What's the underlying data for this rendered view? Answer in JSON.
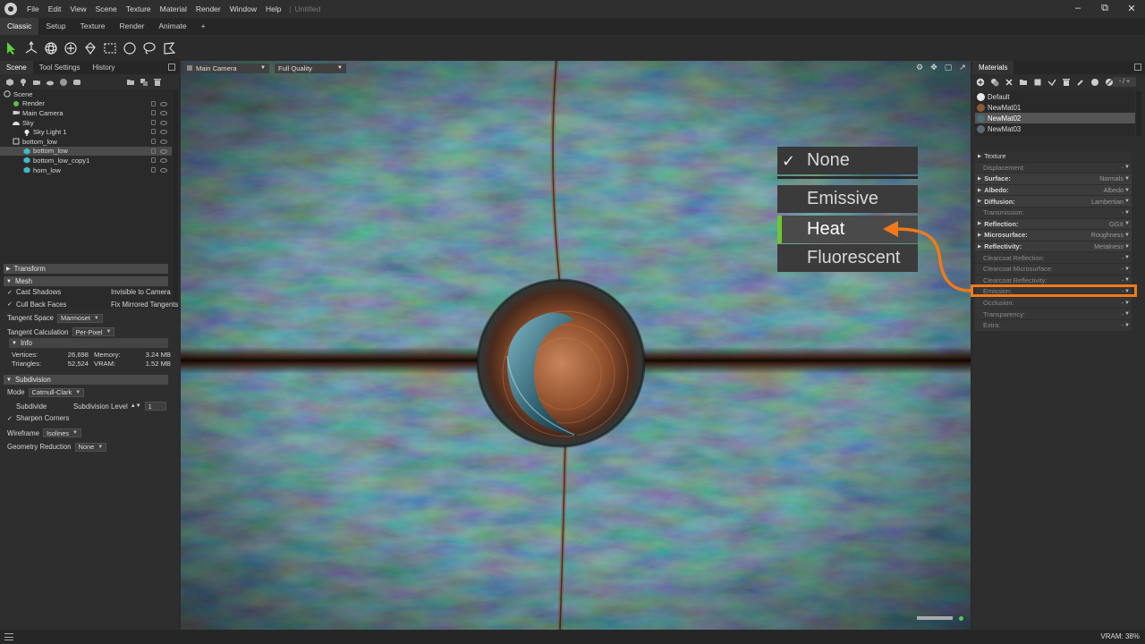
{
  "titlebar": {
    "menu": [
      "File",
      "Edit",
      "View",
      "Scene",
      "Texture",
      "Material",
      "Render",
      "Window",
      "Help"
    ],
    "doc_title": "Untitled"
  },
  "workspace_tabs": [
    "Classic",
    "Setup",
    "Texture",
    "Render",
    "Animate",
    "+"
  ],
  "tools": [
    "select-arrow-icon",
    "move-gizmo-icon",
    "rotate-gizmo-icon",
    "scale-gizmo-icon",
    "paint-icon",
    "rect-select-icon",
    "circle-select-icon",
    "lasso-icon",
    "polygon-select-icon"
  ],
  "left_panel": {
    "tabs": [
      "Scene",
      "Tool Settings",
      "History"
    ],
    "tree": [
      {
        "label": "Scene",
        "indent": 0,
        "icon": "scene-icon"
      },
      {
        "label": "Render",
        "indent": 1,
        "icon": "render-icon"
      },
      {
        "label": "Main Camera",
        "indent": 1,
        "icon": "camera-icon"
      },
      {
        "label": "Sky",
        "indent": 1,
        "icon": "sky-icon"
      },
      {
        "label": "Sky Light 1",
        "indent": 2,
        "icon": "light-icon"
      },
      {
        "label": "bottom_low",
        "indent": 1,
        "icon": "group-icon"
      },
      {
        "label": "bottom_low",
        "indent": 2,
        "icon": "mesh-icon",
        "selected": true
      },
      {
        "label": "bottom_low_copy1",
        "indent": 2,
        "icon": "mesh-icon"
      },
      {
        "label": "horn_low",
        "indent": 2,
        "icon": "mesh-icon"
      }
    ],
    "transform_label": "Transform",
    "mesh_label": "Mesh",
    "cast_shadows": "Cast Shadows",
    "invisible_to_camera": "Invisible to Camera",
    "cull_back_faces": "Cull Back Faces",
    "fix_mirrored": "Fix Mirrored Tangents",
    "tangent_space_label": "Tangent Space",
    "tangent_space_value": "Marmoset",
    "tangent_calc_label": "Tangent Calculation",
    "tangent_calc_value": "Per-Pixel",
    "info_label": "Info",
    "info": {
      "vertices_label": "Vertices:",
      "vertices": "26,698",
      "memory_label": "Memory:",
      "memory": "3.24 MB",
      "triangles_label": "Triangles:",
      "triangles": "52,524",
      "vram_label": "VRAM:",
      "vram": "1.52 MB"
    },
    "subdivision_label": "Subdivision",
    "mode_label": "Mode",
    "mode_value": "Catmull-Clark",
    "subdivide_label": "Subdivide",
    "subdiv_level_label": "Subdivision Level",
    "subdiv_level_value": "1",
    "sharpen_corners": "Sharpen Corners",
    "wireframe_label": "Wireframe",
    "wireframe_value": "Isolines",
    "geo_reduction_label": "Geometry Reduction",
    "geo_reduction_value": "None"
  },
  "viewport": {
    "camera": "Main Camera",
    "quality": "Full Quality"
  },
  "emission_menu": {
    "items": [
      "None",
      "Emissive",
      "Heat",
      "Fluorescent"
    ],
    "checked": "None",
    "highlighted": "Heat"
  },
  "right_panel": {
    "tab": "Materials",
    "filter": "- / +",
    "materials": [
      {
        "name": "Default",
        "color": "#e8e8e8"
      },
      {
        "name": "NewMat01",
        "color": "#8a5a3a"
      },
      {
        "name": "NewMat02",
        "color": "#4a6f7a",
        "selected": true
      },
      {
        "name": "NewMat03",
        "color": "#5a6a74"
      }
    ],
    "properties": [
      {
        "label": "Texture",
        "type": "head"
      },
      {
        "label": "Displacement:",
        "type": "plain",
        "value": ""
      },
      {
        "label": "Surface:",
        "type": "bold",
        "value": "Normals"
      },
      {
        "label": "Albedo:",
        "type": "bold",
        "value": "Albedo"
      },
      {
        "label": "Diffusion:",
        "type": "bold",
        "value": "Lambertian"
      },
      {
        "label": "Transmission:",
        "type": "plain",
        "value": ""
      },
      {
        "label": "Reflection:",
        "type": "bold",
        "value": "GGX"
      },
      {
        "label": "Microsurface:",
        "type": "bold",
        "value": "Roughness"
      },
      {
        "label": "Reflectivity:",
        "type": "bold",
        "value": "Metalness"
      },
      {
        "label": "Clearcoat Reflection:",
        "type": "plain",
        "value": ""
      },
      {
        "label": "Clearcoat Microsurface:",
        "type": "plain",
        "value": ""
      },
      {
        "label": "Clearcoat Reflectivity:",
        "type": "plain",
        "value": ""
      },
      {
        "label": "Emission:",
        "type": "plain",
        "value": ""
      },
      {
        "label": "Occlusion:",
        "type": "plain",
        "value": ""
      },
      {
        "label": "Transparency:",
        "type": "plain",
        "value": ""
      },
      {
        "label": "Extra:",
        "type": "plain",
        "value": ""
      }
    ]
  },
  "status": {
    "vram": "VRAM: 38%"
  },
  "colors": {
    "accent_green": "#6ec531",
    "annotation_orange": "#f07a1a"
  }
}
